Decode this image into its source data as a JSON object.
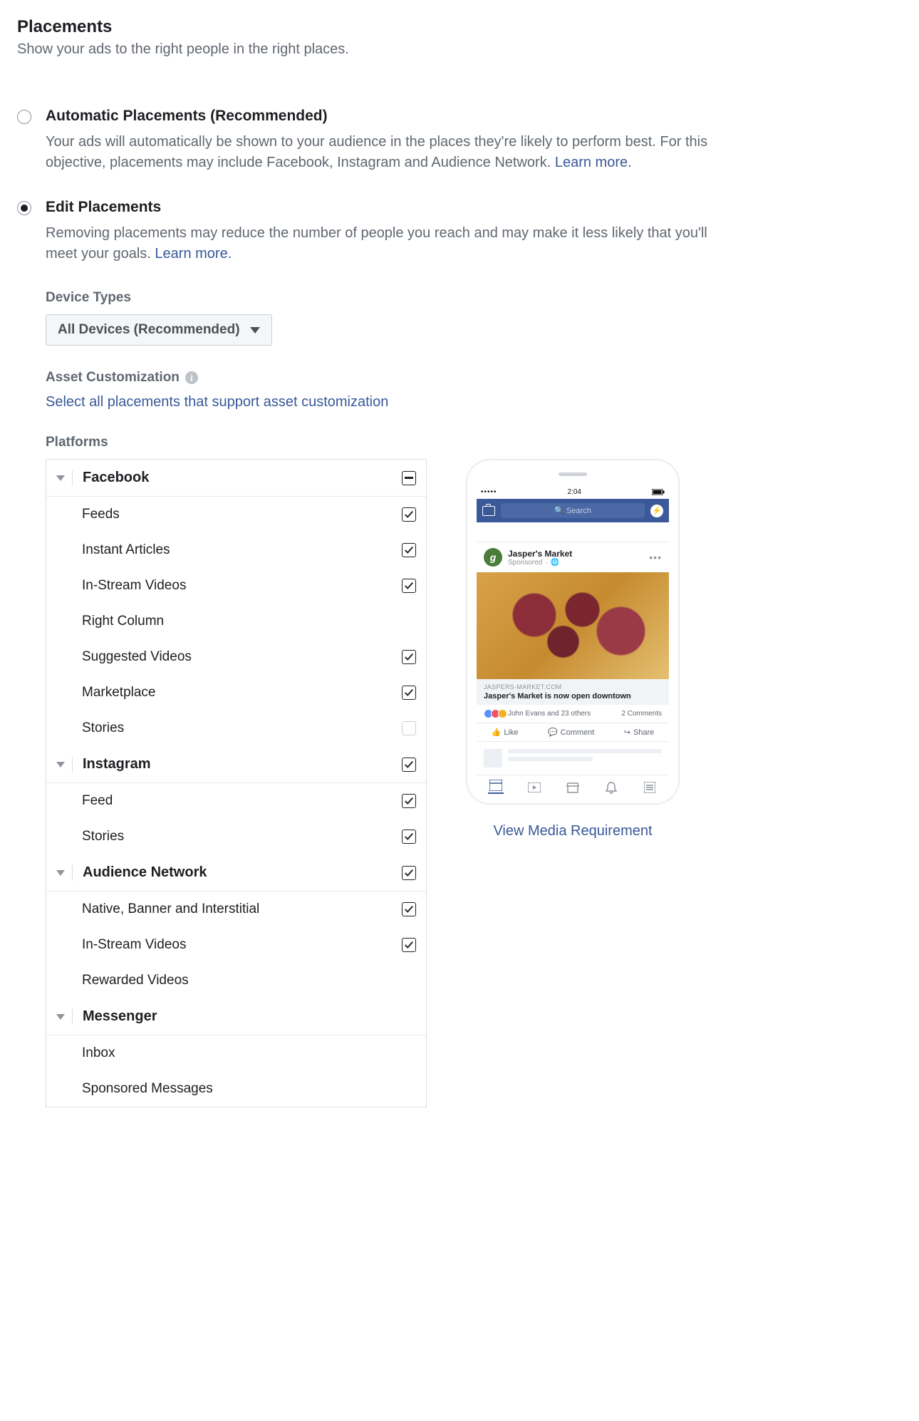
{
  "header": {
    "title": "Placements",
    "subtitle": "Show your ads to the right people in the right places."
  },
  "options": {
    "auto": {
      "label": "Automatic Placements (Recommended)",
      "desc": "Your ads will automatically be shown to your audience in the places they're likely to perform best. For this objective, placements may include Facebook, Instagram and Audience Network. ",
      "learn_more": "Learn more.",
      "selected": false
    },
    "edit": {
      "label": "Edit Placements",
      "desc": "Removing placements may reduce the number of people you reach and may make it less likely that you'll meet your goals. ",
      "learn_more": "Learn more.",
      "selected": true
    }
  },
  "device_types": {
    "label": "Device Types",
    "value": "All Devices (Recommended)"
  },
  "asset_custom": {
    "label": "Asset Customization",
    "link": "Select all placements that support asset customization"
  },
  "platforms_label": "Platforms",
  "platforms": [
    {
      "name": "Facebook",
      "state": "mixed",
      "items": [
        {
          "label": "Feeds",
          "state": "checked"
        },
        {
          "label": "Instant Articles",
          "state": "checked"
        },
        {
          "label": "In-Stream Videos",
          "state": "checked"
        },
        {
          "label": "Right Column",
          "state": "none"
        },
        {
          "label": "Suggested Videos",
          "state": "checked"
        },
        {
          "label": "Marketplace",
          "state": "checked"
        },
        {
          "label": "Stories",
          "state": "unchecked"
        }
      ]
    },
    {
      "name": "Instagram",
      "state": "checked",
      "items": [
        {
          "label": "Feed",
          "state": "checked"
        },
        {
          "label": "Stories",
          "state": "checked"
        }
      ]
    },
    {
      "name": "Audience Network",
      "state": "checked",
      "items": [
        {
          "label": "Native, Banner and Interstitial",
          "state": "checked"
        },
        {
          "label": "In-Stream Videos",
          "state": "checked"
        },
        {
          "label": "Rewarded Videos",
          "state": "none"
        }
      ]
    },
    {
      "name": "Messenger",
      "state": "none",
      "items": [
        {
          "label": "Inbox",
          "state": "none"
        },
        {
          "label": "Sponsored Messages",
          "state": "none"
        }
      ]
    }
  ],
  "preview": {
    "time": "2:04",
    "search_placeholder": "Search",
    "advertiser": "Jasper's Market",
    "sponsored": "Sponsored",
    "domain": "JASPERS-MARKET.COM",
    "headline": "Jasper's Market is now open downtown",
    "reactions": "John Evans and 23 others",
    "comments": "2 Comments",
    "like": "Like",
    "comment": "Comment",
    "share": "Share"
  },
  "media_link": "View Media Requirement"
}
